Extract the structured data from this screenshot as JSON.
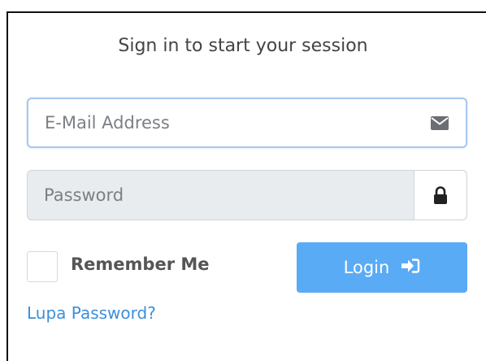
{
  "form": {
    "title": "Sign in to start your session",
    "email_placeholder": "E-Mail Address",
    "password_placeholder": "Password",
    "remember_label": "Remember Me",
    "login_label": "Login",
    "forgot_label": "Lupa Password?"
  },
  "icons": {
    "email": "envelope-icon",
    "password": "lock-icon",
    "login": "sign-in-arrow-icon"
  },
  "colors": {
    "primary": "#5aabf5",
    "link": "#3d8fd9",
    "focus_border": "#a9c8ef",
    "disabled_bg": "#e9ecef"
  }
}
